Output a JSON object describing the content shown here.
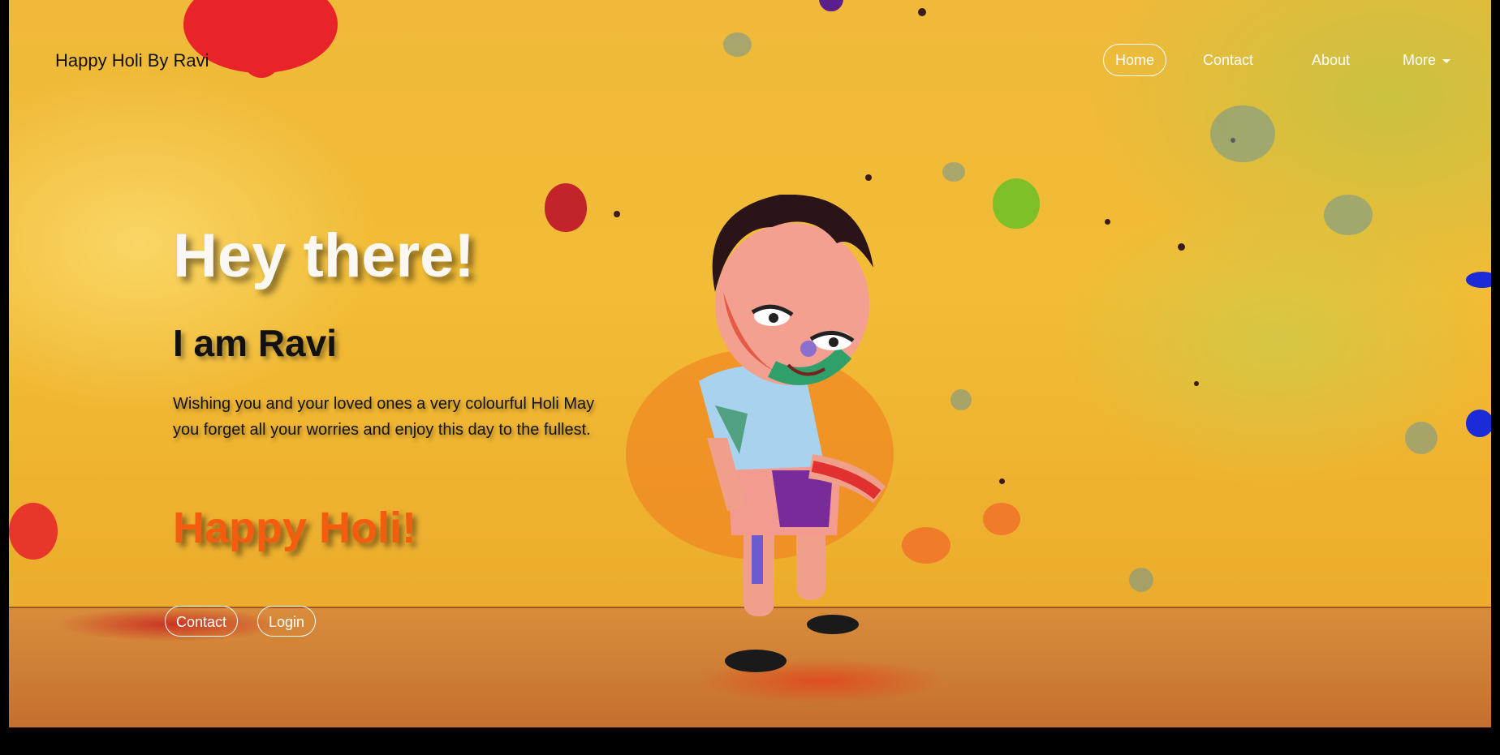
{
  "navbar": {
    "brand": "Happy Holi By Ravi",
    "links": [
      {
        "label": "Home",
        "active": true
      },
      {
        "label": "Contact",
        "active": false
      },
      {
        "label": "About",
        "active": false
      },
      {
        "label": "More",
        "active": false,
        "dropdown": true
      }
    ]
  },
  "hero": {
    "title": "Hey there!",
    "subtitle": "I am Ravi",
    "message": "Wishing you and your loved ones a very colourful Holi May you forget all your worries and enjoy this day to the fullest.",
    "greeting": "Happy Holi!",
    "buttons": {
      "contact": "Contact",
      "login": "Login"
    }
  },
  "colors": {
    "background": "#f0b93a",
    "greeting": "#f45d10",
    "title": "#fbf8f3",
    "nav_text": "#ffffff"
  }
}
